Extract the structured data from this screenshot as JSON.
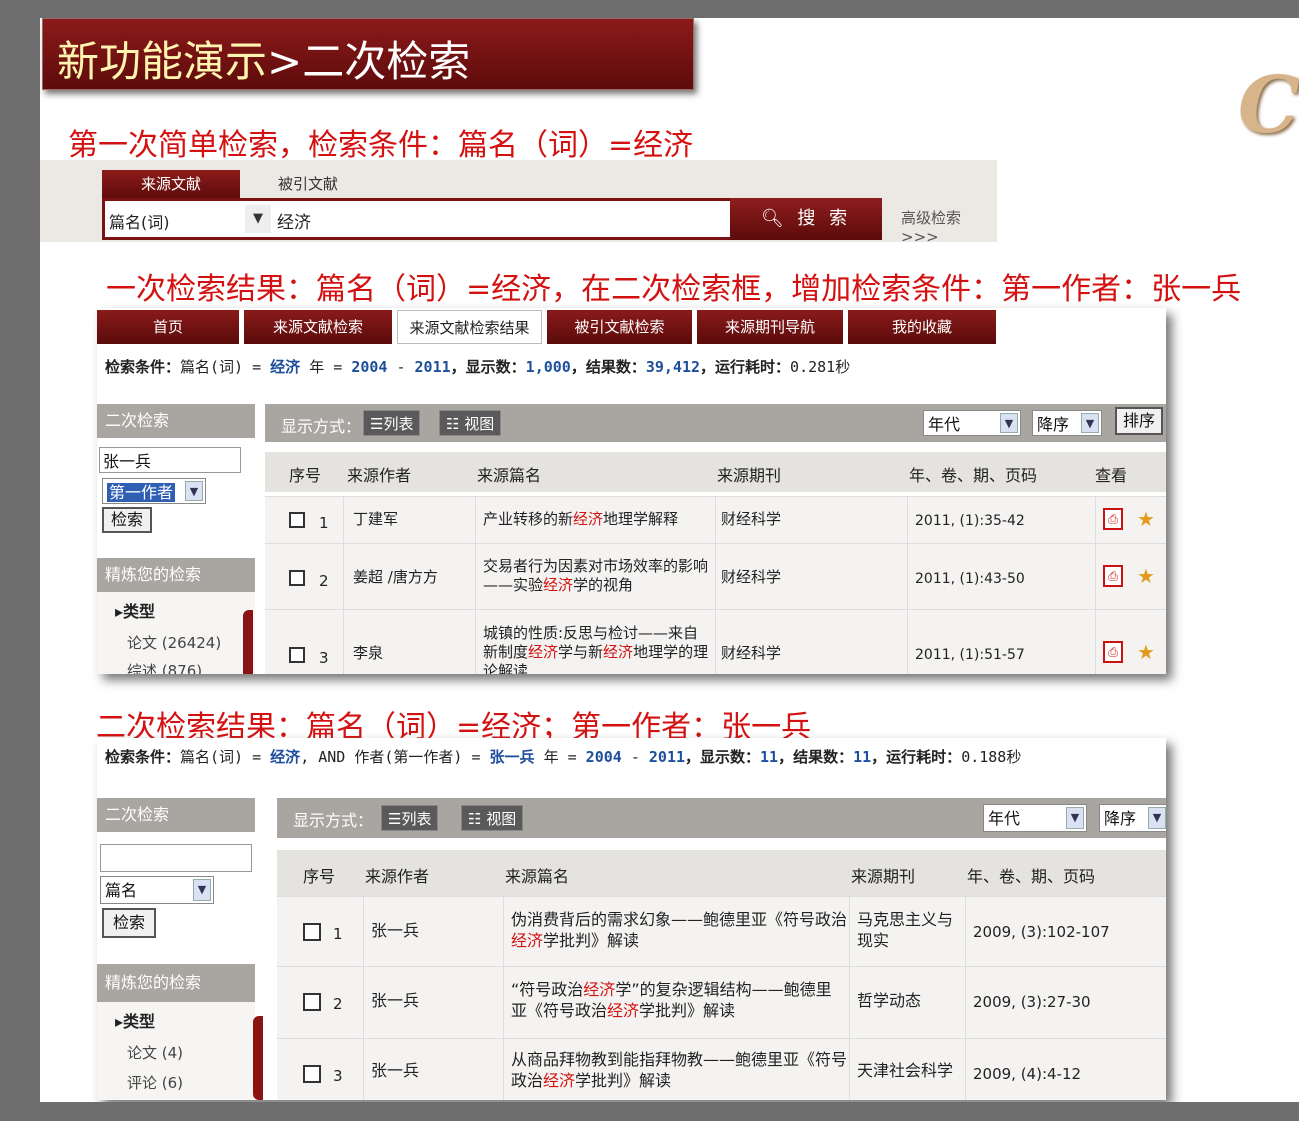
{
  "slide_title": {
    "main": "新功能演示",
    "sub": ">二次检索"
  },
  "logo_letter": "C",
  "captions": {
    "first": "第一次简单检索，检索条件：篇名（词）=经济",
    "second": "一次检索结果：篇名（词）=经济，在二次检索框，增加检索条件：第一作者：张一兵",
    "third": "二次检索结果：篇名（词）=经济；第一作者：张一兵"
  },
  "search": {
    "tab_active": "来源文献",
    "tab_inactive": "被引文献",
    "field": "篇名(词)",
    "value": "经济",
    "button": "搜 索",
    "advanced": "高级检索>>>"
  },
  "panel1": {
    "nav": [
      "首页",
      "来源文献检索",
      "来源文献检索结果",
      "被引文献检索",
      "来源期刊导航",
      "我的收藏"
    ],
    "condition": {
      "label": "检索条件：",
      "field": "篇名(词) = ",
      "kw": "经济",
      "year_label": " 年 = ",
      "year_from": "2004",
      "dash": " - ",
      "year_to": "2011",
      "shown_label": "，显示数：",
      "shown": "1,000",
      "total_label": "，结果数：",
      "total": "39,412",
      "time_label": "，运行耗时：",
      "time": "0.281秒"
    },
    "sidebar": {
      "header": "二次检索",
      "input_value": "张一兵",
      "field": "第一作者",
      "button": "检索",
      "refine_header": "精炼您的检索",
      "type_label": "▸类型",
      "types": [
        "论文 (26424)",
        "综述 (876)"
      ]
    },
    "toolbar": {
      "label": "显示方式：",
      "list": "☰列表",
      "view": "☷ 视图",
      "sort_field": "年代",
      "sort_order": "降序",
      "sort_btn": "排序"
    },
    "headers": [
      "序号",
      "来源作者",
      "来源篇名",
      "来源期刊",
      "年、卷、期、页码",
      "查看"
    ],
    "rows": [
      {
        "no": "1",
        "author": "丁建军",
        "title_pre": "产业转移的新",
        "title_kw": "经济",
        "title_post": "地理学解释",
        "journal": "财经科学",
        "pages": "2011, (1):35-42"
      },
      {
        "no": "2",
        "author": "姜超 /唐方方",
        "title_pre": "交易者行为因素对市场效率的影响——实验",
        "title_kw": "经济",
        "title_post": "学的视角",
        "journal": "财经科学",
        "pages": "2011, (1):43-50"
      },
      {
        "no": "3",
        "author": "李泉",
        "title_pre": "城镇的性质:反思与检讨——来自新制度",
        "title_kw": "经济",
        "title_mid": "学与新",
        "title_kw2": "经济",
        "title_post": "地理学的理论解读",
        "journal": "财经科学",
        "pages": "2011, (1):51-57"
      }
    ]
  },
  "panel2": {
    "condition": {
      "label": "检索条件：",
      "field": "篇名(词) = ",
      "kw": "经济",
      "and_part": ", AND 作者(第一作者) = ",
      "author": "张一兵",
      "year_label": " 年 = ",
      "year_from": "2004",
      "dash": " - ",
      "year_to": "2011",
      "shown_label": "，显示数：",
      "shown": "11",
      "total_label": "，结果数：",
      "total": "11",
      "time_label": "，运行耗时：",
      "time": "0.188秒"
    },
    "sidebar": {
      "header": "二次检索",
      "input_value": "",
      "field": "篇名",
      "button": "检索",
      "refine_header": "精炼您的检索",
      "type_label": "▸类型",
      "types": [
        "论文 (4)",
        "评论 (6)"
      ]
    },
    "toolbar": {
      "label": "显示方式：",
      "list": "☰列表",
      "view": "☷ 视图",
      "sort_field": "年代",
      "sort_order": "降序"
    },
    "headers": [
      "序号",
      "来源作者",
      "来源篇名",
      "来源期刊",
      "年、卷、期、页码"
    ],
    "rows": [
      {
        "no": "1",
        "author": "张一兵",
        "title_pre": "伪消费背后的需求幻象——鲍德里亚《符号政治",
        "title_kw": "经济",
        "title_post": "学批判》解读",
        "journal": "马克思主义与现实",
        "pages": "2009, (3):102-107"
      },
      {
        "no": "2",
        "author": "张一兵",
        "title_pre": "“符号政治",
        "title_kw": "经济",
        "title_mid": "学”的复杂逻辑结构——鲍德里亚《符号政治",
        "title_kw2": "经济",
        "title_post": "学批判》解读",
        "journal": "哲学动态",
        "pages": "2009, (3):27-30"
      },
      {
        "no": "3",
        "author": "张一兵",
        "title_pre": "从商品拜物教到能指拜物教——鲍德里亚《符号政治",
        "title_kw": "经济",
        "title_post": "学批判》解读",
        "journal": "天津社会科学",
        "pages": "2009, (4):4-12"
      }
    ]
  }
}
